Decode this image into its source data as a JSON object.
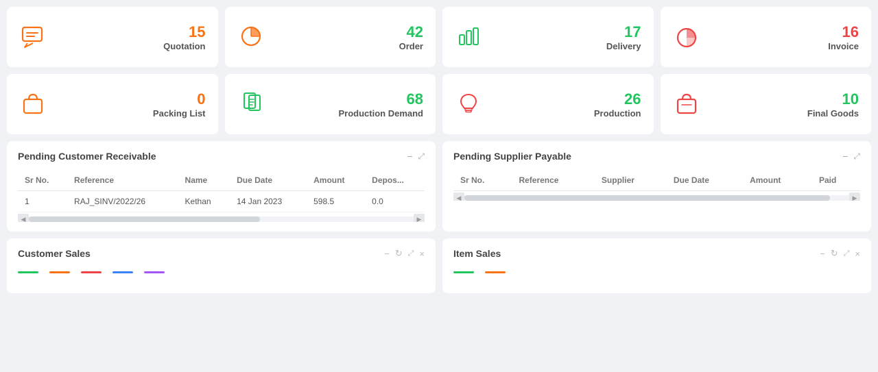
{
  "stat_cards_row1": [
    {
      "id": "quotation",
      "icon": "chat",
      "count": "15",
      "label": "Quotation",
      "count_color": "orange",
      "icon_color": "orange"
    },
    {
      "id": "order",
      "icon": "pie",
      "count": "42",
      "label": "Order",
      "count_color": "green",
      "icon_color": "orange"
    },
    {
      "id": "delivery",
      "icon": "bar",
      "count": "17",
      "label": "Delivery",
      "count_color": "green",
      "icon_color": "green"
    },
    {
      "id": "invoice",
      "icon": "pie2",
      "count": "16",
      "label": "Invoice",
      "count_color": "red",
      "icon_color": "red"
    }
  ],
  "stat_cards_row2": [
    {
      "id": "packing",
      "icon": "bag",
      "count": "0",
      "label": "Packing List",
      "count_color": "orange",
      "icon_color": "orange"
    },
    {
      "id": "production_demand",
      "icon": "docs",
      "count": "68",
      "label": "Production Demand",
      "count_color": "green",
      "icon_color": "green"
    },
    {
      "id": "production",
      "icon": "bulb",
      "count": "26",
      "label": "Production",
      "count_color": "green",
      "icon_color": "red"
    },
    {
      "id": "final_goods",
      "icon": "bag2",
      "count": "10",
      "label": "Final Goods",
      "count_color": "green",
      "icon_color": "red"
    }
  ],
  "pending_customer": {
    "title": "Pending Customer Receivable",
    "columns": [
      "Sr No.",
      "Reference",
      "Name",
      "Due Date",
      "Amount",
      "Depos..."
    ],
    "rows": [
      [
        "1",
        "RAJ_SINV/2022/26",
        "Kethan",
        "14 Jan 2023",
        "598.5",
        "0.0"
      ]
    ]
  },
  "pending_supplier": {
    "title": "Pending Supplier Payable",
    "columns": [
      "Sr No.",
      "Reference",
      "Supplier",
      "Due Date",
      "Amount",
      "Paid"
    ],
    "rows": []
  },
  "customer_sales": {
    "title": "Customer Sales",
    "chart_lines": [
      {
        "color": "#22c55e"
      },
      {
        "color": "#f97316"
      },
      {
        "color": "#ef4444"
      },
      {
        "color": "#3b82f6"
      },
      {
        "color": "#a855f7"
      }
    ]
  },
  "item_sales": {
    "title": "Item Sales",
    "chart_lines": [
      {
        "color": "#22c55e"
      },
      {
        "color": "#f97316"
      }
    ]
  },
  "controls": {
    "minimize": "−",
    "expand": "⤢",
    "refresh": "↻",
    "close": "×",
    "arrow_left": "◀",
    "arrow_right": "▶"
  }
}
